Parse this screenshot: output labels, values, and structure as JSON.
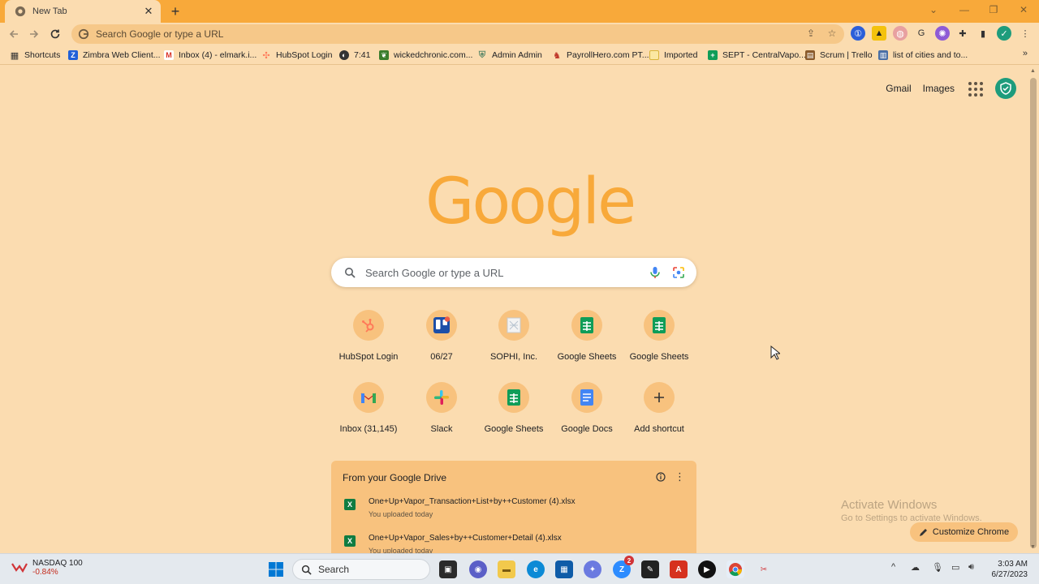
{
  "tab": {
    "title": "New Tab"
  },
  "omnibox": {
    "placeholder": "Search Google or type a URL"
  },
  "bookmarks": [
    {
      "label": "Shortcuts",
      "icon": "grid-icon",
      "color": "#333333"
    },
    {
      "label": "Zimbra Web Client...",
      "icon": "zimbra-icon",
      "color": "#2160d8"
    },
    {
      "label": "Inbox (4) - elmark.i...",
      "icon": "gmail-icon",
      "color": "#d93025"
    },
    {
      "label": "HubSpot Login",
      "icon": "hubspot-icon",
      "color": "#ff7a59"
    },
    {
      "label": "7:41",
      "icon": "globe-icon",
      "color": "#333333"
    },
    {
      "label": "wickedchronic.com...",
      "icon": "leaf-icon",
      "color": "#3a7d2c"
    },
    {
      "label": "Admin Admin",
      "icon": "shield-icon",
      "color": "#5f8a6a"
    },
    {
      "label": "PayrollHero.com PT...",
      "icon": "payrollhero-icon",
      "color": "#c0392b"
    },
    {
      "label": "Imported",
      "icon": "folder-icon",
      "color": "#f2c94c"
    },
    {
      "label": "SEPT - CentralVapo...",
      "icon": "sheets-icon",
      "color": "#0f9d58"
    },
    {
      "label": "Scrum | Trello",
      "icon": "trello-icon",
      "color": "#8a5a2b"
    },
    {
      "label": "list of cities and to...",
      "icon": "map-icon",
      "color": "#4a6fa5"
    }
  ],
  "top_links": {
    "gmail": "Gmail",
    "images": "Images"
  },
  "logo": {
    "text": "Google"
  },
  "search": {
    "placeholder": "Search Google or type a URL"
  },
  "shortcuts": [
    {
      "label": "HubSpot Login",
      "icon": "hubspot-icon"
    },
    {
      "label": "06/27",
      "icon": "trello-icon"
    },
    {
      "label": "SOPHI, Inc.",
      "icon": "sophi-icon"
    },
    {
      "label": "Google Sheets",
      "icon": "sheets-icon"
    },
    {
      "label": "Google Sheets",
      "icon": "sheets-icon"
    },
    {
      "label": "Inbox (31,145)",
      "icon": "gmail-icon"
    },
    {
      "label": "Slack",
      "icon": "slack-icon"
    },
    {
      "label": "Google Sheets",
      "icon": "sheets-icon"
    },
    {
      "label": "Google Docs",
      "icon": "docs-icon"
    },
    {
      "label": "Add shortcut",
      "icon": "plus-icon"
    }
  ],
  "drive": {
    "title": "From your Google Drive",
    "files": [
      {
        "name": "One+Up+Vapor_Transaction+List+by++Customer (4).xlsx",
        "sub": "You uploaded today"
      },
      {
        "name": "One+Up+Vapor_Sales+by++Customer+Detail (4).xlsx",
        "sub": "You uploaded today"
      }
    ]
  },
  "watermark": {
    "line1": "Activate Windows",
    "line2": "Go to Settings to activate Windows."
  },
  "customize": {
    "label": "Customize Chrome"
  },
  "taskbar": {
    "ticker_name": "NASDAQ 100",
    "ticker_change": "-0.84%",
    "search": "Search",
    "time": "3:03 AM",
    "date": "6/27/2023",
    "chat_badge": "2"
  },
  "colors": {
    "accent": "#f8a93a",
    "page_bg": "#fbdcb0",
    "shortcut_circle": "#f8c27e"
  }
}
